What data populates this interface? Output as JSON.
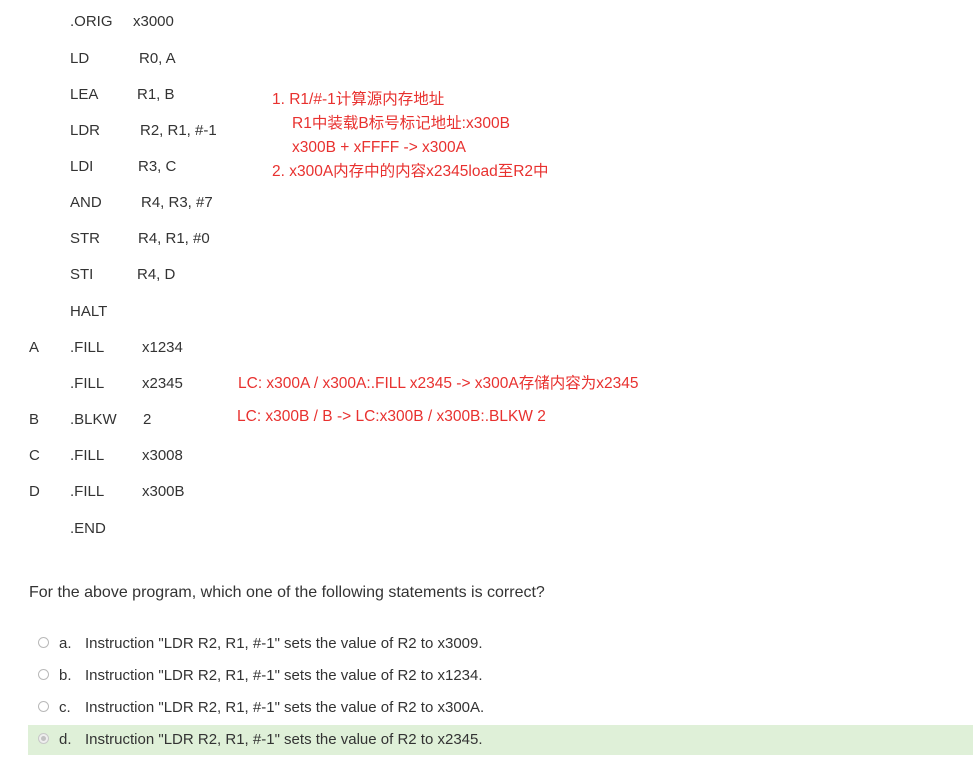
{
  "program": {
    "lines": [
      {
        "label": "",
        "op": ".ORIG",
        "arg": "x3000"
      },
      {
        "label": "",
        "op": "LD",
        "arg": "R0, A"
      },
      {
        "label": "",
        "op": "LEA",
        "arg": "R1, B"
      },
      {
        "label": "",
        "op": "LDR",
        "arg": "R2, R1, #-1"
      },
      {
        "label": "",
        "op": "LDI",
        "arg": "R3, C"
      },
      {
        "label": "",
        "op": "AND",
        "arg": "R4, R3, #7"
      },
      {
        "label": "",
        "op": "STR",
        "arg": "R4, R1, #0"
      },
      {
        "label": "",
        "op": "STI",
        "arg": "R4, D"
      },
      {
        "label": "",
        "op": "HALT",
        "arg": ""
      },
      {
        "label": "A",
        "op": ".FILL",
        "arg": "x1234"
      },
      {
        "label": "",
        "op": ".FILL",
        "arg": "x2345"
      },
      {
        "label": "B",
        "op": ".BLKW",
        "arg": "2"
      },
      {
        "label": "C",
        "op": ".FILL",
        "arg": "x3008"
      },
      {
        "label": "D",
        "op": ".FILL",
        "arg": "x300B"
      },
      {
        "label": "",
        "op": ".END",
        "arg": ""
      }
    ]
  },
  "annotations": {
    "ldr_note": [
      "1. R1/#-1计算源内存地址",
      "R1中装载B标号标记地址:x300B",
      "x300B + xFFFF -> x300A",
      "2. x300A内存中的内容x2345load至R2中"
    ],
    "fill_note": "LC: x300A /  x300A:.FILL x2345 -> x300A存储内容为x2345",
    "blkw_note": "LC: x300B / B -> LC:x300B / x300B:.BLKW 2",
    "color": "#e8312f"
  },
  "question": {
    "text": "For the above program, which one of the following statements is correct?",
    "options": [
      {
        "letter": "a.",
        "text": "Instruction \"LDR R2, R1, #-1\" sets the value of R2 to x3009.",
        "selected": false
      },
      {
        "letter": "b.",
        "text": "Instruction \"LDR R2, R1, #-1\" sets the value of R2 to x1234.",
        "selected": false
      },
      {
        "letter": "c.",
        "text": "Instruction \"LDR R2, R1, #-1\" sets the value of R2 to x300A.",
        "selected": false
      },
      {
        "letter": "d.",
        "text": "Instruction \"LDR R2, R1, #-1\" sets the value of R2 to x2345.",
        "selected": true
      }
    ],
    "selected_color": "#dff0d8"
  }
}
